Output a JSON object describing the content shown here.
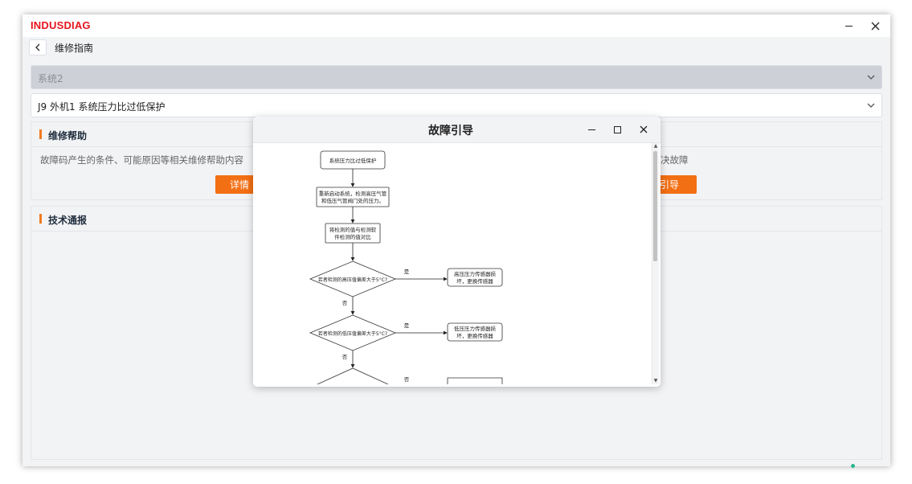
{
  "app": {
    "brand": "INDUSDIAG"
  },
  "window_controls": {
    "minimize": "−",
    "close": "✕"
  },
  "nav": {
    "title": "维修指南"
  },
  "system_select": {
    "value": "系统2"
  },
  "fault_select": {
    "value": "J9 外机1 系统压力比过低保护"
  },
  "help_panel": {
    "title": "维修帮助",
    "description": "故障码产生的条件、可能原因等相关维修帮助内容",
    "description_tail": "决故障",
    "details_button": "详情",
    "guide_button": "引导"
  },
  "tech_panel": {
    "title": "技术通报"
  },
  "modal": {
    "title": "故障引导",
    "flowchart": {
      "start": "系统压力比过低保护",
      "step1_line1": "重新启动系统，检测高压气管",
      "step1_line2": "和低压气管阀门处的压力。",
      "step2_line1": "将检测的值与检测软",
      "step2_line2": "件检测的值对比",
      "decision1": "若者检测的高压值偏差大于5°C?",
      "decision2": "若者检测的低压值偏差大于5°C?",
      "result1_line1": "高压压力传感器损",
      "result1_line2": "坏，更换传感器",
      "result2_line1": "低压压力传感器损",
      "result2_line2": "坏，更换传感器",
      "yes": "是",
      "no": "否"
    }
  },
  "colors": {
    "brand": "#e6141e",
    "accent": "#f07a1e",
    "button": "#f36f13"
  },
  "icons": [
    "back-icon",
    "minimize-icon",
    "close-icon",
    "chevron-down-icon",
    "maximize-icon"
  ]
}
